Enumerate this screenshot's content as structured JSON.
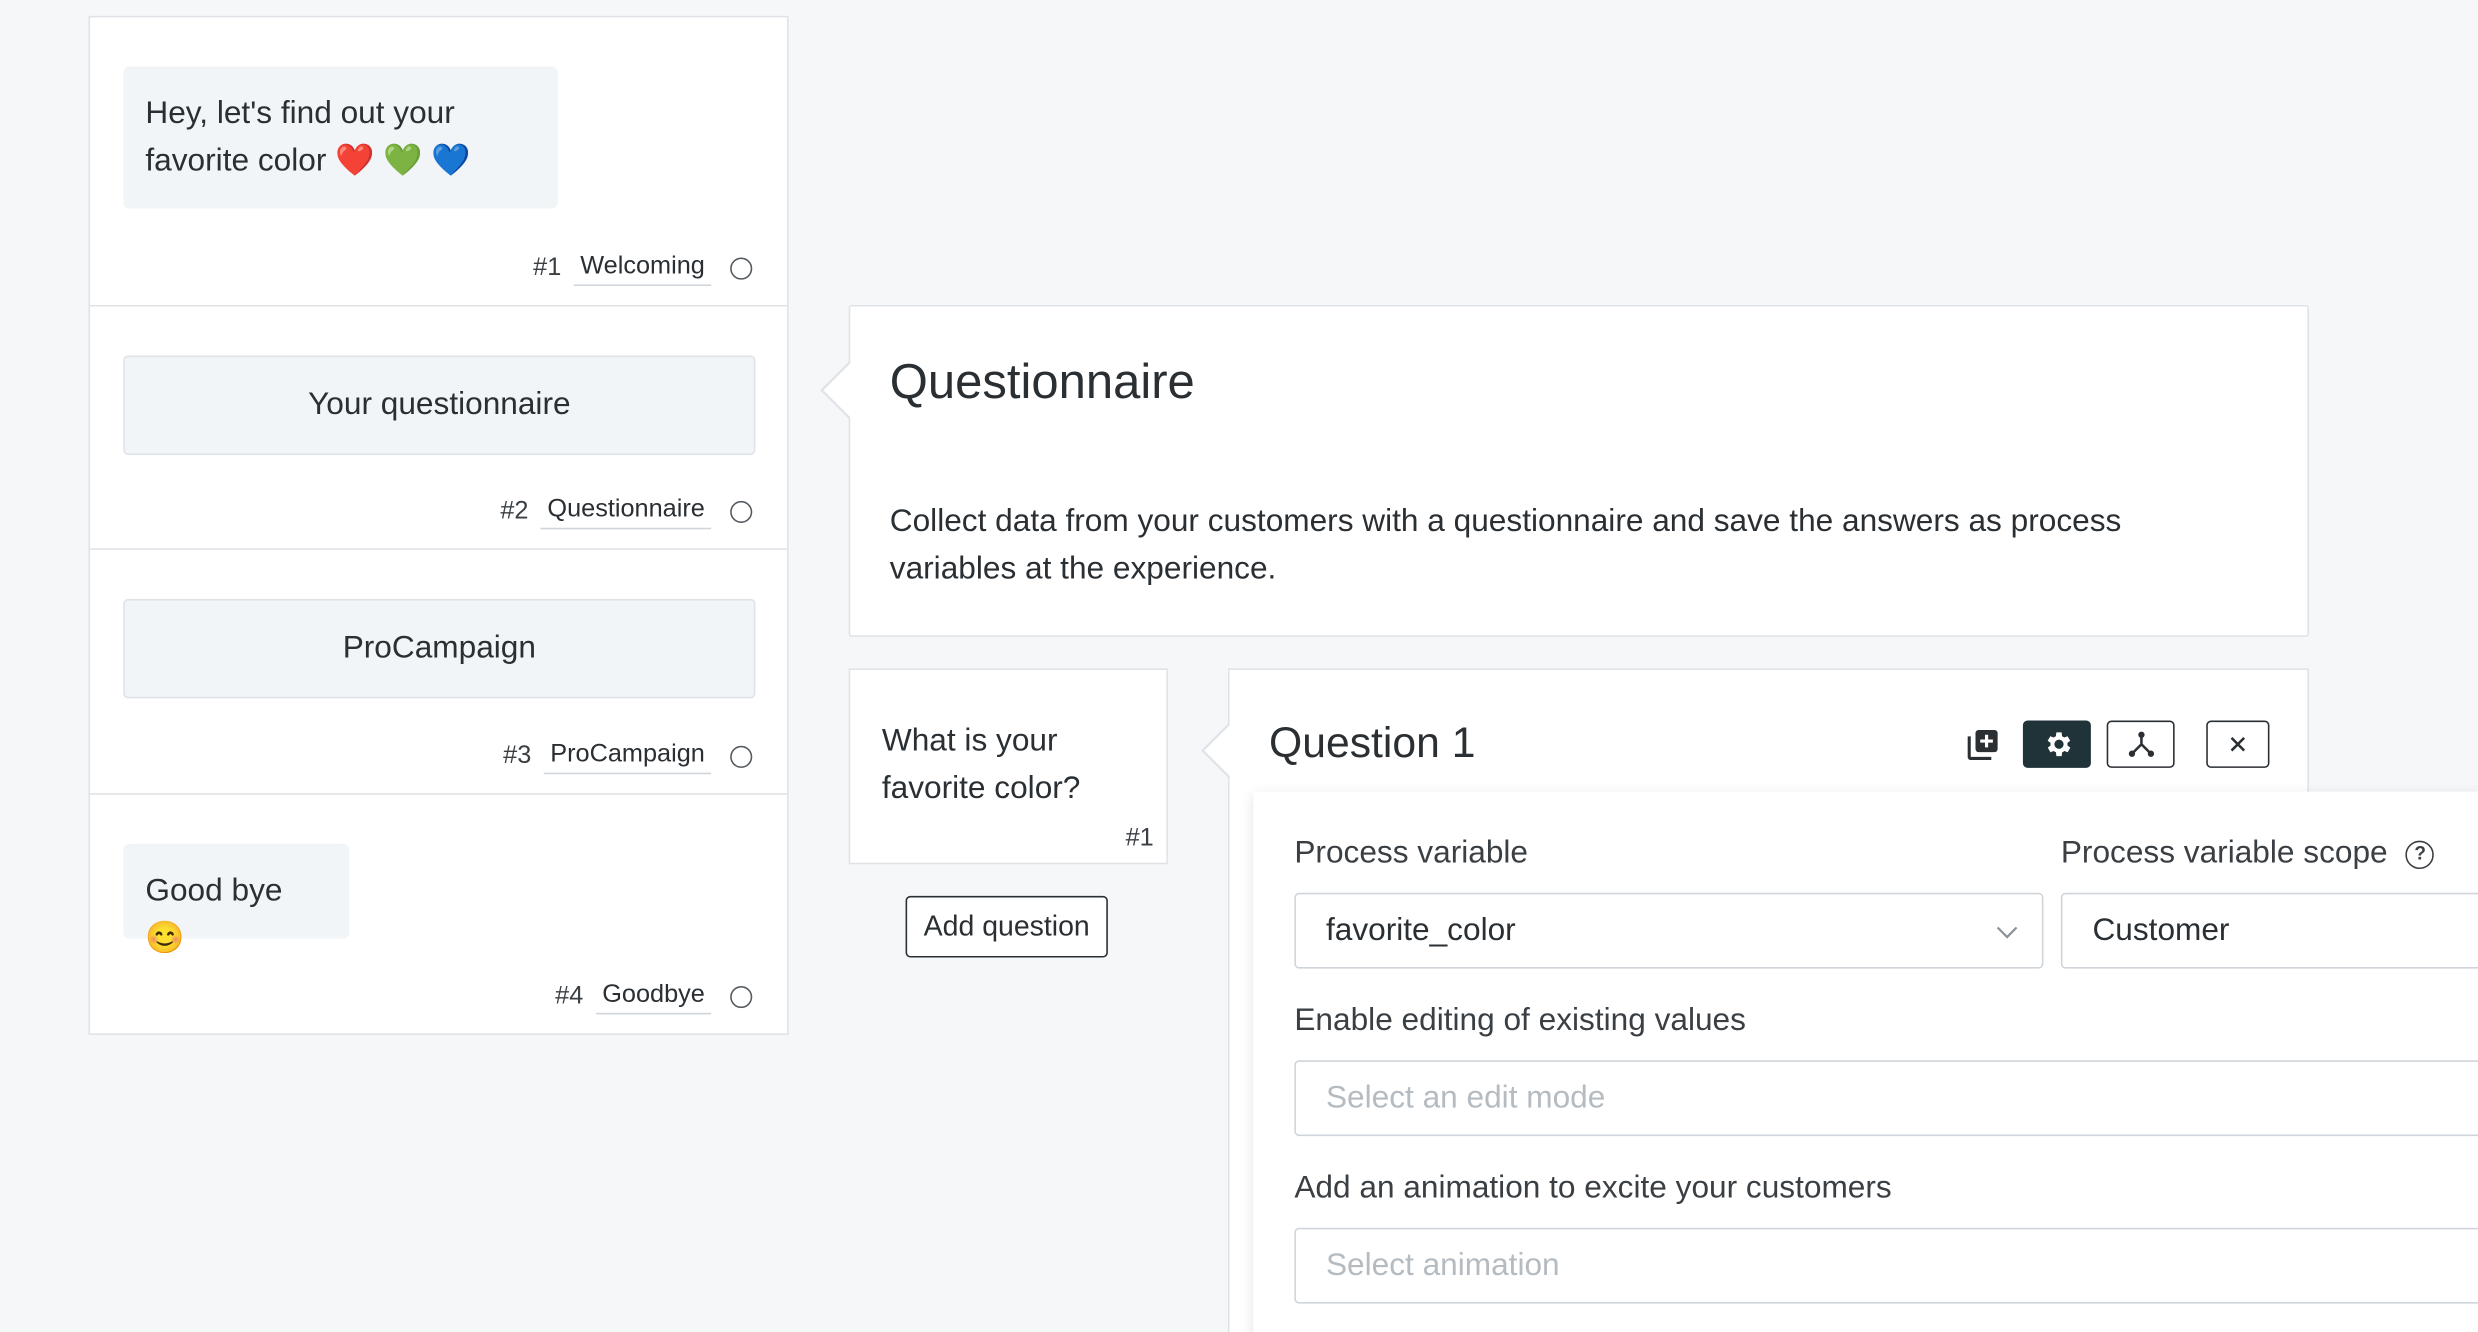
{
  "steps": [
    {
      "text": "Hey, let's find out your favorite color ❤️ 💚 💙",
      "num": "#1",
      "tag": "Welcoming"
    },
    {
      "text": "Your questionnaire",
      "num": "#2",
      "tag": "Questionnaire"
    },
    {
      "text": "ProCampaign",
      "num": "#3",
      "tag": "ProCampaign"
    },
    {
      "text": "Good bye 😊",
      "num": "#4",
      "tag": "Goodbye"
    }
  ],
  "questionnaire": {
    "title": "Questionnaire",
    "description": "Collect data from your customers with a questionnaire and save the answers as process variables at the experience."
  },
  "question_list": {
    "items": [
      {
        "text": "What is your favorite color?",
        "num": "#1"
      }
    ],
    "add_label": "Add question"
  },
  "question_detail": {
    "title": "Question 1",
    "tools": [
      "add-icon",
      "gear-icon",
      "branch-icon",
      "close-icon"
    ],
    "accent": "#1f3338"
  },
  "settings": {
    "process_variable_label": "Process variable",
    "process_variable_value": "favorite_color",
    "scope_label": "Process variable scope",
    "scope_value": "Customer",
    "edit_label": "Enable editing of existing values",
    "edit_placeholder": "Select an edit mode",
    "animation_label": "Add an animation to excite your customers",
    "animation_placeholder": "Select animation"
  }
}
